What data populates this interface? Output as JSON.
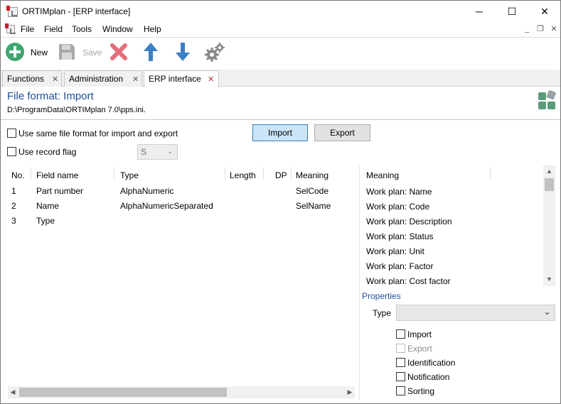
{
  "window": {
    "title": "ORTIMplan - [ERP interface]"
  },
  "window_controls": {
    "minimize": "─",
    "maximize": "☐",
    "close": "✕"
  },
  "menu": [
    "File",
    "Field",
    "Tools",
    "Window",
    "Help"
  ],
  "mdi_controls": {
    "minimize": "_",
    "restore": "❐",
    "close": "✕"
  },
  "toolbar": {
    "new_label": "New",
    "save_label": "Save"
  },
  "tabs": [
    {
      "label": "Functions",
      "close": "✕"
    },
    {
      "label": "Administration",
      "close": "✕"
    },
    {
      "label": "ERP interface",
      "close": "✕"
    }
  ],
  "page": {
    "title": "File format: Import",
    "path": "D:\\ProgramData\\ORTIMplan 7.0\\pps.ini."
  },
  "options": {
    "same_format_label": "Use same file format for import and export",
    "record_flag_label": "Use record flag",
    "record_flag_value": "S",
    "import_button": "Import",
    "export_button": "Export"
  },
  "fields_table": {
    "headers": [
      "No.",
      "Field name",
      "Type",
      "Length",
      "DP",
      "Meaning"
    ],
    "rows": [
      {
        "no": "1",
        "name": "Part number",
        "type": "AlphaNumeric",
        "length": "",
        "dp": "",
        "meaning": "SelCode"
      },
      {
        "no": "2",
        "name": "Name",
        "type": "AlphaNumericSeparated",
        "length": "",
        "dp": "",
        "meaning": "SelName"
      },
      {
        "no": "3",
        "name": "Type",
        "type": "",
        "length": "",
        "dp": "",
        "meaning": ""
      }
    ]
  },
  "meaning_list": {
    "header": "Meaning",
    "items": [
      "Work plan: Name",
      "Work plan: Code",
      "Work plan: Description",
      "Work plan: Status",
      "Work plan: Unit",
      "Work plan: Factor",
      "Work plan: Cost factor"
    ]
  },
  "properties": {
    "title": "Properties",
    "type_label": "Type",
    "type_value": "",
    "checkboxes": [
      {
        "label": "Import",
        "enabled": true
      },
      {
        "label": "Export",
        "enabled": false
      },
      {
        "label": "Identification",
        "enabled": true
      },
      {
        "label": "Notification",
        "enabled": true
      },
      {
        "label": "Sorting",
        "enabled": true
      }
    ]
  },
  "colors": {
    "accent": "#1f4e9c",
    "pressed_button": "#cce4f7",
    "close_red": "#c02c2c"
  },
  "icons": {
    "new": "plus-circle-icon",
    "save": "floppy-disk-icon",
    "delete": "red-x-icon",
    "up": "arrow-up-icon",
    "down": "arrow-down-icon",
    "settings": "gears-icon",
    "brand": "ortim-logo-icon"
  }
}
